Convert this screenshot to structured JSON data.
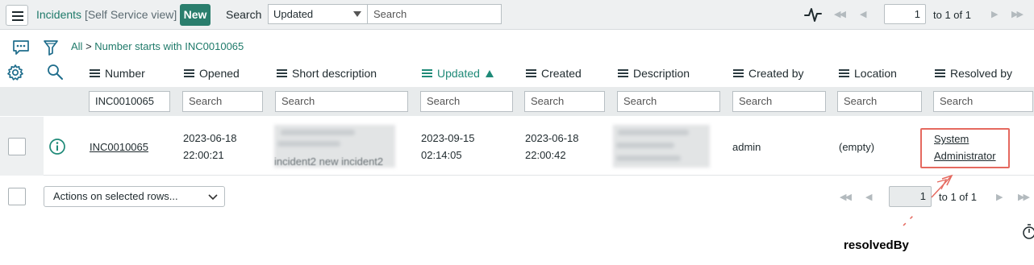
{
  "header": {
    "title": "Incidents",
    "view": "[Self Service view]",
    "new_label": "New",
    "search_label": "Search",
    "search_field": "Updated",
    "search_placeholder": "Search",
    "page_current": "1",
    "page_info": "to 1 of 1"
  },
  "breadcrumb": {
    "all": "All",
    "separator": ">",
    "condition": "Number starts with INC0010065"
  },
  "columns": [
    {
      "label": "Number"
    },
    {
      "label": "Opened"
    },
    {
      "label": "Short description"
    },
    {
      "label": "Updated",
      "sorted": "ascending"
    },
    {
      "label": "Created"
    },
    {
      "label": "Description"
    },
    {
      "label": "Created by"
    },
    {
      "label": "Location"
    },
    {
      "label": "Resolved by"
    }
  ],
  "filters": {
    "number": "INC0010065",
    "placeholder": "Search"
  },
  "row": {
    "number": "INC0010065",
    "opened_date": "2023-06-18",
    "opened_time": "22:00:21",
    "short_description_visible": "incident2 new incident2",
    "updated_date": "2023-09-15",
    "updated_time": "02:14:05",
    "created_date": "2023-06-18",
    "created_time": "22:00:42",
    "created_by": "admin",
    "location": "(empty)",
    "resolved_by_line1": "System",
    "resolved_by_line2": "Administrator"
  },
  "footer": {
    "actions_label": "Actions on selected rows...",
    "page_current": "1",
    "page_info": "to 1 of 1"
  },
  "annotation": {
    "label": "resolvedBy",
    "color": "#e5695f"
  },
  "colors": {
    "accent": "#1f7a6a",
    "new_button": "#2a7e6d",
    "sorted_column": "#1f8a78"
  }
}
